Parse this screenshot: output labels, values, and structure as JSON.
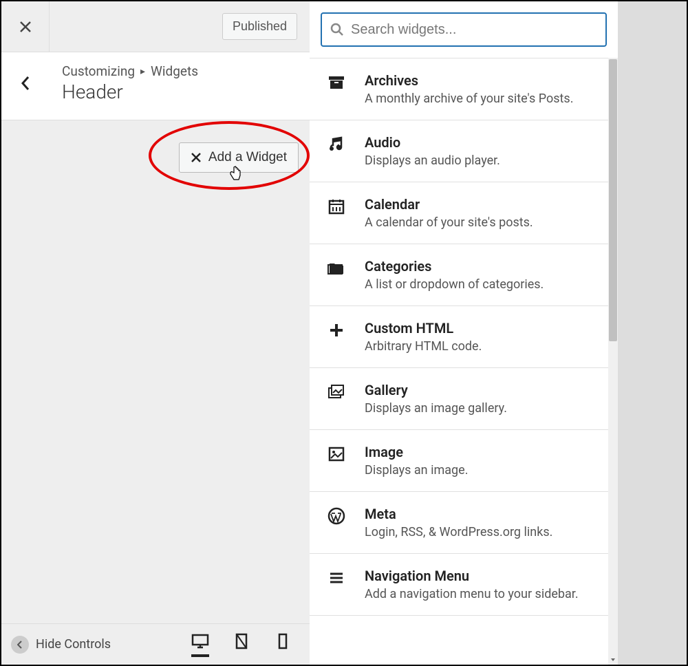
{
  "topbar": {
    "publish_label": "Published"
  },
  "breadcrumb": {
    "customizing": "Customizing",
    "widgets": "Widgets"
  },
  "section": {
    "title": "Header"
  },
  "add_widget": {
    "label": "Add a Widget"
  },
  "footer": {
    "hide_label": "Hide Controls"
  },
  "search": {
    "placeholder": "Search widgets..."
  },
  "widgets": [
    {
      "icon": "archive",
      "title": "Archives",
      "desc": "A monthly archive of your site's Posts."
    },
    {
      "icon": "audio",
      "title": "Audio",
      "desc": "Displays an audio player."
    },
    {
      "icon": "calendar",
      "title": "Calendar",
      "desc": "A calendar of your site's posts."
    },
    {
      "icon": "categories",
      "title": "Categories",
      "desc": "A list or dropdown of categories."
    },
    {
      "icon": "plus",
      "title": "Custom HTML",
      "desc": "Arbitrary HTML code."
    },
    {
      "icon": "gallery",
      "title": "Gallery",
      "desc": "Displays an image gallery."
    },
    {
      "icon": "image",
      "title": "Image",
      "desc": "Displays an image."
    },
    {
      "icon": "wordpress",
      "title": "Meta",
      "desc": "Login, RSS, & WordPress.org links."
    },
    {
      "icon": "menu",
      "title": "Navigation Menu",
      "desc": "Add a navigation menu to your sidebar."
    }
  ]
}
